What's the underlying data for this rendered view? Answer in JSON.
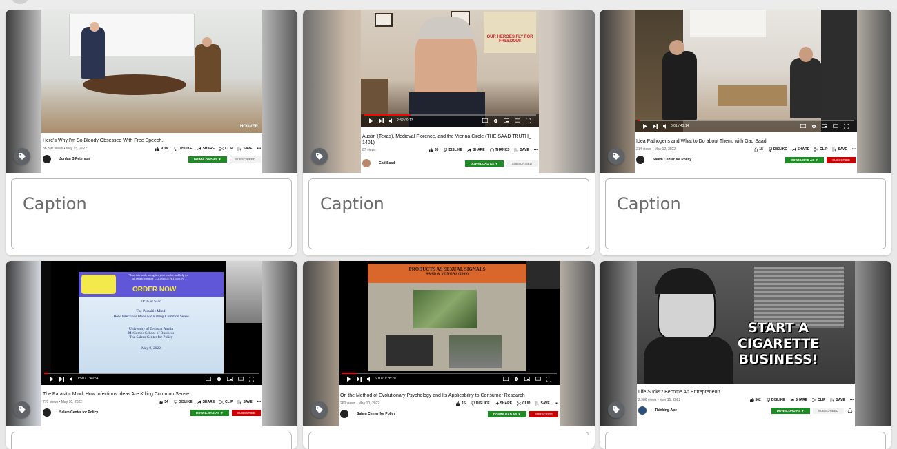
{
  "caption_placeholder": "Caption",
  "colors": {
    "background": "#e8e8e8",
    "card": "#ffffff",
    "tag_button": "#5f6368",
    "download": "#1f8b24",
    "subscribe": "#cc0000",
    "progress": "#ff0000"
  },
  "icons": {
    "tag": "tag-icon",
    "play": "play-icon",
    "next": "next-icon",
    "volume": "volume-icon",
    "settings": "gear-icon",
    "fullscreen": "fullscreen-icon"
  },
  "labels": {
    "dislike": "DISLIKE",
    "share": "SHARE",
    "clip": "CLIP",
    "save": "SAVE",
    "thanks": "THANKS",
    "download": "DOWNLOAD AS ▼",
    "subscribed": "SUBSCRIBED",
    "subscribe": "SUBSCRIBE"
  },
  "cards": [
    {
      "title": "Here's Why I'm So Bloody Obsessed With Free Speech..",
      "stats": "86,390 views • May 15, 2022",
      "likes": "9.3K",
      "channel": "Jordan B Peterson",
      "time": "",
      "watermark": "HOOVER"
    },
    {
      "title": "Austin (Texas), Medieval Florence, and the Vienna Circle (THE SAAD TRUTH_ 1401)",
      "stats": "87 views",
      "likes": "30",
      "channel": "Gad Saad",
      "time": "2:32 / 9:13",
      "poster": "OUR HEROES FLY FOR FREEDOM!"
    },
    {
      "title": "Idea Pathogens and What to Do about Them, with Gad Saad",
      "stats": "214 views • May 12, 2022",
      "likes": "18",
      "channel": "Salem Center for Policy",
      "time": "0:01 / 43:14"
    },
    {
      "title": "The Parasitic Mind: How Infectious Ideas Are Killing Common Sense",
      "stats": "770 views • May 10, 2022",
      "likes": "34",
      "channel": "Salem Center for Policy",
      "time": "1:50 / 1:49:54",
      "slide": {
        "order": "ORDER NOW",
        "quote": "\"Read this book, strengthen your resolve, and help us all return to reason\" —JORDAN PETERSON",
        "author": "Dr. Gad Saad",
        "book": "The Parasitic Mind:",
        "subtitle": "How Infectious Ideas Are Killing Common Sense",
        "inst1": "University of Texas at Austin",
        "inst2": "McCombs School of Business",
        "inst3": "The Salem Center for Policy",
        "date": "May 9, 2022"
      }
    },
    {
      "title": "On the Method of Evolutionary Psychology and Its Applicability to Consumer Research",
      "stats": "260 views • May 10, 2022",
      "likes": "15",
      "channel": "Salem Center for Policy",
      "time": "6:10 / 1:28:20",
      "slide": {
        "heading": "PRODUCTS AS SEXUAL SIGNALS",
        "sub": "SAAD & VONGAS (2009)"
      }
    },
    {
      "title": "Life Sucks? Become An Entrepreneur!",
      "stats": "2,986 views • May 15, 2022",
      "likes": "502",
      "channel": "Thinking-Ape",
      "time": "",
      "banner": {
        "l1": "START A",
        "l2": "CIGARETTE",
        "l3": "BUSINESS!"
      }
    }
  ]
}
